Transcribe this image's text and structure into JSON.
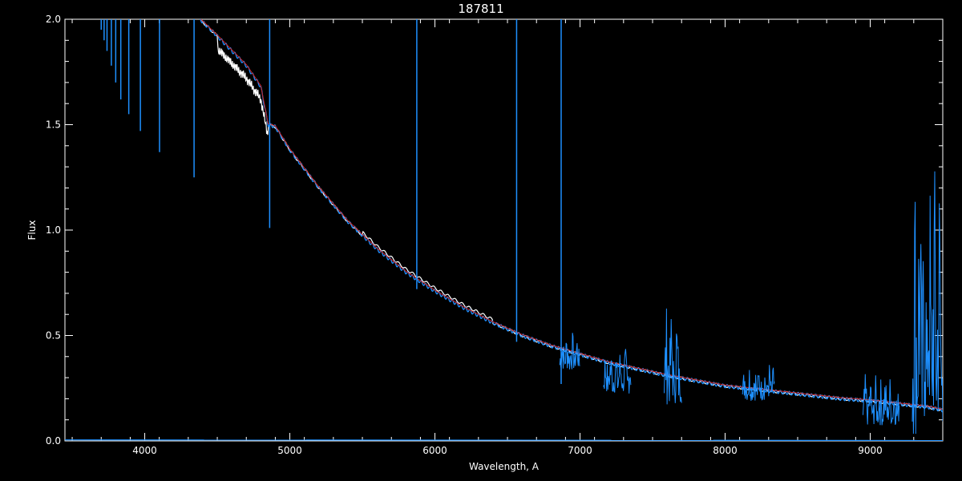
{
  "chart_data": {
    "type": "line",
    "title": "187811",
    "xlabel": "Wavelength, A",
    "ylabel": "Flux",
    "xlim": [
      3450,
      9500
    ],
    "ylim": [
      0,
      2.0
    ],
    "x_ticks": [
      4000,
      5000,
      6000,
      7000,
      8000,
      9000
    ],
    "y_ticks": [
      0.0,
      0.5,
      1.0,
      1.5,
      2.0
    ],
    "x_tick_labels": [
      "4000",
      "5000",
      "6000",
      "7000",
      "8000",
      "9000"
    ],
    "y_tick_labels": [
      "0.0",
      "0.5",
      "1.0",
      "1.5",
      "2.0"
    ],
    "grid": false,
    "colors": {
      "background": "#000000",
      "axes": "#ffffff",
      "observed_white": "#ffffff",
      "observed_blue": "#1e90ff",
      "model_red": "#d02020"
    },
    "continuum": {
      "x": [
        4380,
        4500,
        4600,
        4700,
        4800,
        4850,
        4900,
        5000,
        5200,
        5400,
        5600,
        5800,
        6000,
        6200,
        6400,
        6600,
        6800,
        7000,
        7200,
        7400,
        7600,
        7800,
        8000,
        8200,
        8400,
        8600,
        8800,
        9000,
        9200,
        9400,
        9500
      ],
      "y": [
        2.0,
        1.92,
        1.85,
        1.78,
        1.68,
        1.5,
        1.49,
        1.38,
        1.2,
        1.04,
        0.91,
        0.8,
        0.71,
        0.63,
        0.56,
        0.5,
        0.45,
        0.41,
        0.37,
        0.34,
        0.31,
        0.285,
        0.26,
        0.245,
        0.23,
        0.215,
        0.2,
        0.19,
        0.175,
        0.16,
        0.145
      ]
    },
    "absorption_lines": [
      {
        "x": 3700,
        "y_min": 1.95
      },
      {
        "x": 3720,
        "y_min": 1.9
      },
      {
        "x": 3740,
        "y_min": 1.85
      },
      {
        "x": 3770,
        "y_min": 1.78
      },
      {
        "x": 3800,
        "y_min": 1.7
      },
      {
        "x": 3835,
        "y_min": 1.62
      },
      {
        "x": 3890,
        "y_min": 1.55
      },
      {
        "x": 3970,
        "y_min": 1.47
      },
      {
        "x": 4102,
        "y_min": 1.37
      },
      {
        "x": 4340,
        "y_min": 1.25
      },
      {
        "x": 4861,
        "y_min": 1.01
      },
      {
        "x": 5875,
        "y_min": 0.72
      },
      {
        "x": 6563,
        "y_min": 0.47
      },
      {
        "x": 6870,
        "y_min": 0.27
      }
    ],
    "telluric_bands": [
      {
        "x_start": 6860,
        "x_end": 7000,
        "y_min": 0.33,
        "y_max": 0.53
      },
      {
        "x_start": 7160,
        "x_end": 7350,
        "y_min": 0.22,
        "y_max": 0.45
      },
      {
        "x_start": 7580,
        "x_end": 7700,
        "y_min": 0.17,
        "y_max": 0.65
      },
      {
        "x_start": 8120,
        "x_end": 8340,
        "y_min": 0.19,
        "y_max": 0.38
      },
      {
        "x_start": 8950,
        "x_end": 9200,
        "y_min": 0.07,
        "y_max": 0.32
      },
      {
        "x_start": 9290,
        "x_end": 9500,
        "y_min": 0.0,
        "y_max": 1.37
      }
    ],
    "baseline": {
      "x": [
        3450,
        9500
      ],
      "y": [
        0.005,
        0.002
      ]
    }
  }
}
